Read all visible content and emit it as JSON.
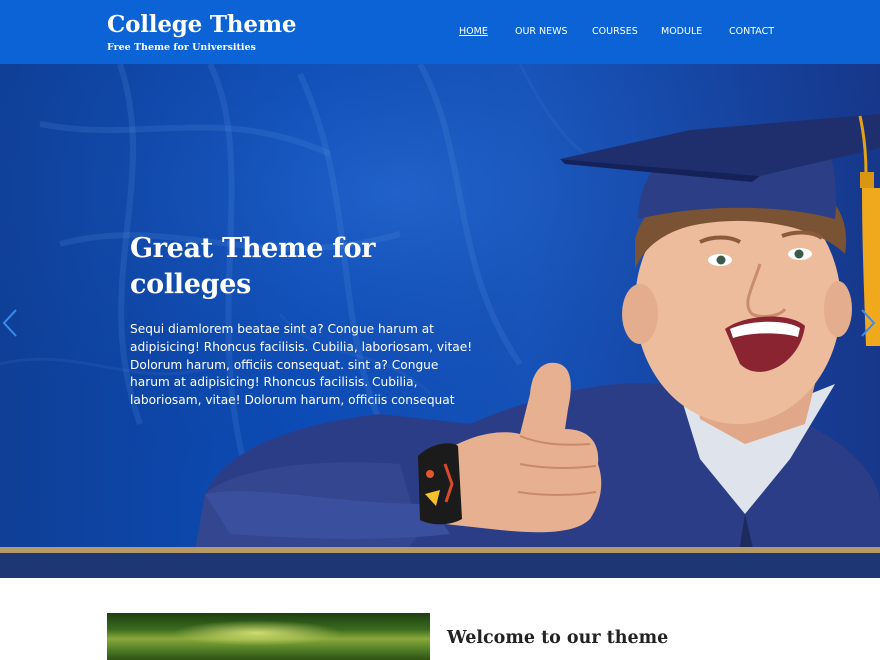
{
  "header": {
    "site_title": "College Theme",
    "tagline": "Free Theme for Universities",
    "background_color": "#0c63d6"
  },
  "nav": {
    "items": [
      {
        "label": "HOME",
        "active": true
      },
      {
        "label": "OUR NEWS",
        "active": false
      },
      {
        "label": "COURSES",
        "active": false
      },
      {
        "label": "MODULE",
        "active": false
      },
      {
        "label": "CONTACT",
        "active": false
      }
    ]
  },
  "hero": {
    "heading": "Great Theme for colleges",
    "body": "Sequi diamlorem beatae sint a? Congue harum at adipisicing! Rhoncus facilisis. Cubilia, laboriosam, vitae! Dolorum harum, officiis consequat. sint a? Congue harum at adipisicing! Rhoncus facilisis. Cubilia, laboriosam, vitae! Dolorum harum, officiis consequat",
    "prev_icon": "chevron-left-icon",
    "next_icon": "chevron-right-icon",
    "accent_color": "#b59966",
    "overlay_color": "#0b4cb8"
  },
  "welcome": {
    "heading": "Welcome to our theme"
  }
}
